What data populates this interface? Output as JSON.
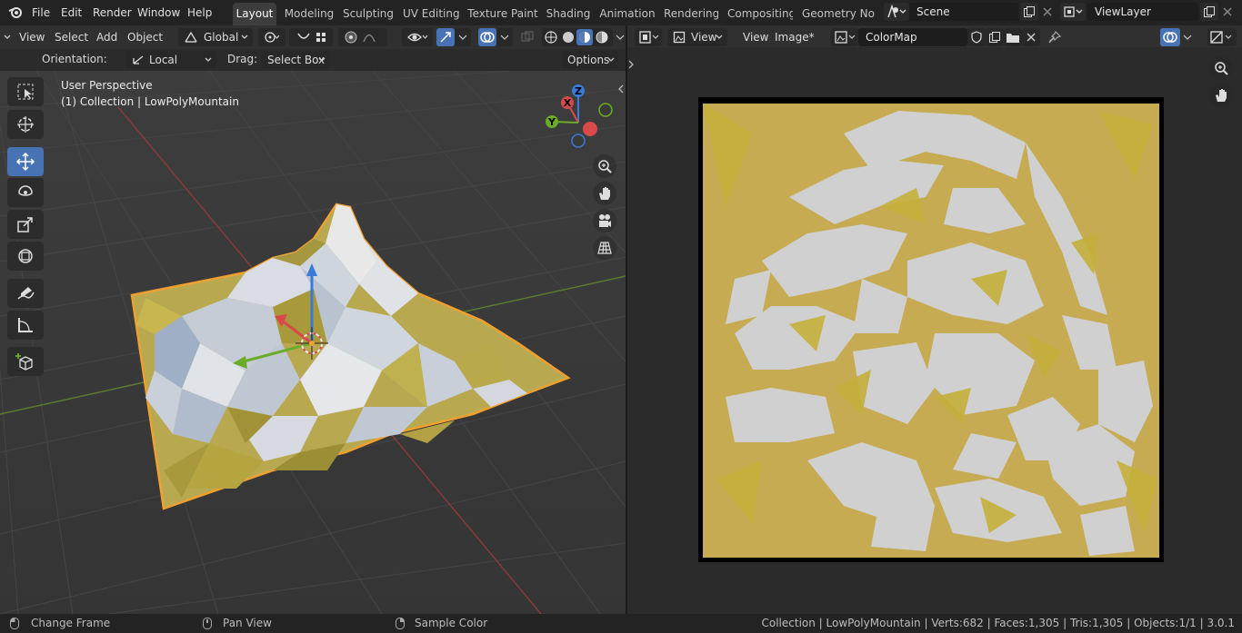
{
  "menu": {
    "items": [
      "File",
      "Edit",
      "Render",
      "Window",
      "Help"
    ]
  },
  "workspaces": [
    "Layout",
    "Modeling",
    "Sculpting",
    "UV Editing",
    "Texture Paint",
    "Shading",
    "Animation",
    "Rendering",
    "Compositing",
    "Geometry Nod"
  ],
  "active_workspace": "Layout",
  "scene": {
    "name": "Scene"
  },
  "view_layer": {
    "name": "ViewLayer"
  },
  "viewport_header": {
    "menus": [
      "View",
      "Select",
      "Add",
      "Object"
    ],
    "transform_orientation": "Global"
  },
  "tool_settings": {
    "orientation_label": "Orientation:",
    "orientation_value": "Local",
    "drag_label": "Drag:",
    "drag_value": "Select Box",
    "options_label": "Options"
  },
  "viewport": {
    "perspective": "User Perspective",
    "collection_info": "(1) Collection | LowPolyMountain",
    "gizmo_axes": [
      "X",
      "Y",
      "Z"
    ]
  },
  "image_editor": {
    "view_menu": "View",
    "menus": [
      "View",
      "Image*"
    ],
    "image_name": "ColorMap"
  },
  "statusbar": {
    "hint1": "Change Frame",
    "hint2": "Pan View",
    "hint3": "Sample Color",
    "stats": "Collection | LowPolyMountain | Verts:682 | Faces:1,305 | Tris:1,305 | Objects:1/1 | 3.0.1"
  },
  "colors": {
    "accent": "#4772b3",
    "selection_outline": "#f0a030",
    "mesh_yellow": "#c9b040",
    "mesh_white": "#d6d6d6"
  }
}
